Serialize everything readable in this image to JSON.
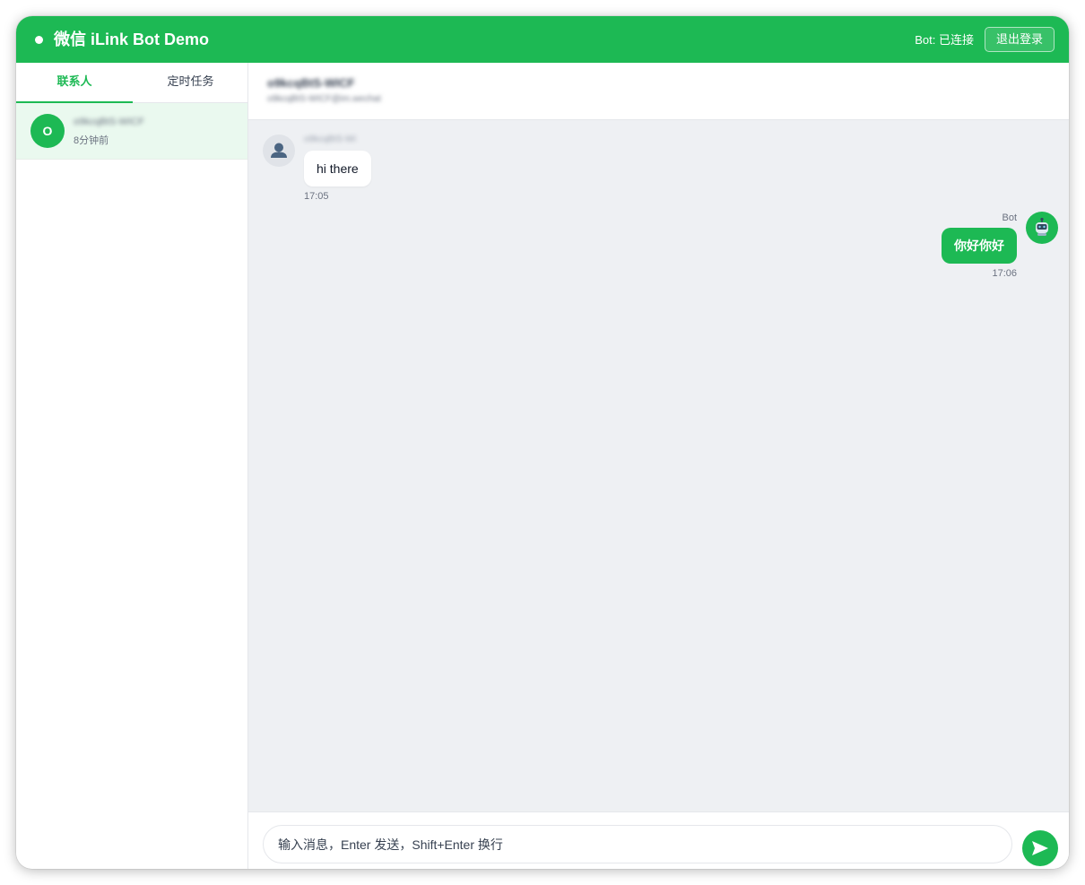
{
  "header": {
    "title": "微信 iLink Bot Demo",
    "bot_status": "Bot: 已连接",
    "logout_label": "退出登录"
  },
  "sidebar": {
    "tabs": [
      {
        "label": "联系人",
        "active": true
      },
      {
        "label": "定时任务",
        "active": false
      }
    ],
    "contacts": [
      {
        "avatar_letter": "O",
        "name": "o9kcqBtS-WICF",
        "last_active": "8分钟前"
      }
    ]
  },
  "chat": {
    "title": "o9kcqBtS-WICF",
    "subtitle": "o9kcqBtS-WICF@im.wechat",
    "messages": [
      {
        "direction": "incoming",
        "sender": "o9kcqBtS-Wi",
        "text": "hi there",
        "time": "17:05"
      },
      {
        "direction": "outgoing",
        "sender": "Bot",
        "text": "你好你好",
        "time": "17:06"
      }
    ],
    "composer": {
      "placeholder": "输入消息，Enter 发送，Shift+Enter 换行"
    }
  },
  "icons": {
    "status": "status-dot-icon",
    "user_avatar": "user-silhouette-icon",
    "bot_avatar": "robot-icon",
    "send": "send-arrow-icon"
  },
  "colors": {
    "accent": "#1db954",
    "chat_background": "#eef0f3",
    "active_contact_background": "#eaf9ef"
  }
}
